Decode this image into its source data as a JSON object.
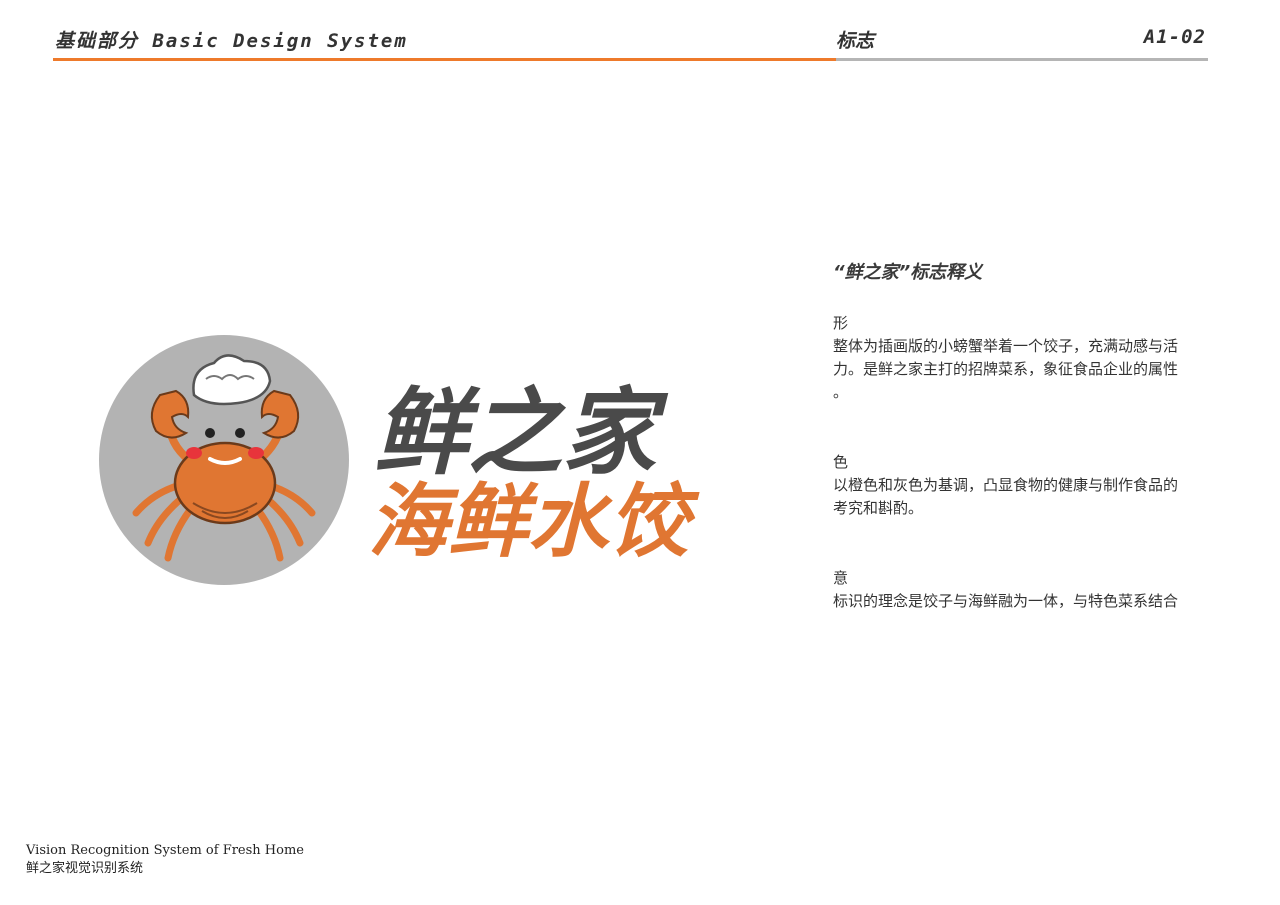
{
  "header": {
    "section": "基础部分  Basic Design System",
    "title": "标志",
    "page_code": "A1-02"
  },
  "colors": {
    "accent_orange": "#ee7a2b",
    "logo_orange": "#e07632",
    "logo_gray": "#4a4a4a",
    "circle_gray": "#b3b3b3",
    "rule_gray": "#b5b5b5"
  },
  "logo": {
    "name_line": "鲜之家",
    "product_line": "海鲜水饺",
    "mascot": "crab-holding-dumpling-icon"
  },
  "description": {
    "title": "“鲜之家”标志释义",
    "sections": [
      {
        "heading": "形",
        "lines": [
          "整体为插画版的小螃蟹举着一个饺子，充满动感与活",
          "力。是鲜之家主打的招牌菜系，象征食品企业的属性",
          "。"
        ]
      },
      {
        "heading": "色",
        "lines": [
          "以橙色和灰色为基调，凸显食物的健康与制作食品的",
          "考究和斟酌。"
        ]
      },
      {
        "heading": "意",
        "lines": [
          "标识的理念是饺子与海鲜融为一体，与特色菜系结合"
        ]
      }
    ]
  },
  "footer": {
    "en": "Vision Recognition System of Fresh Home",
    "cn": "鲜之家视觉识别系统"
  }
}
